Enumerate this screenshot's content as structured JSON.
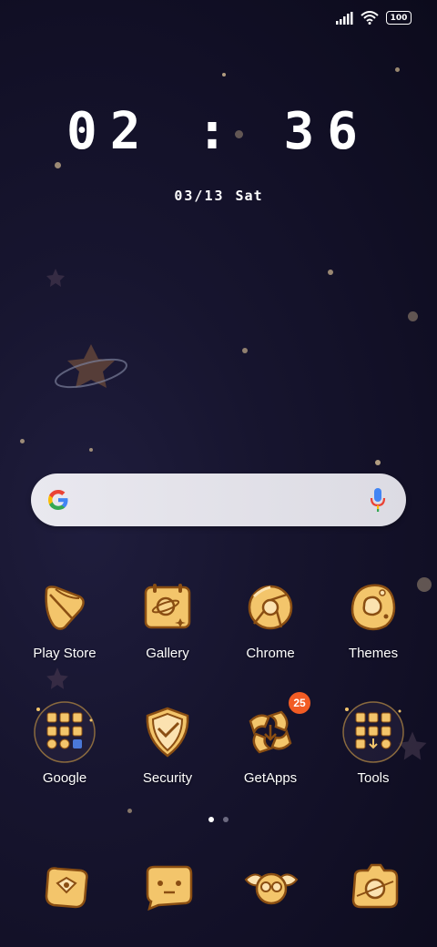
{
  "status_bar": {
    "signal_icon": "signal-bars-icon",
    "wifi_icon": "wifi-icon",
    "battery_level": "100"
  },
  "clock": {
    "time": "02 : 36",
    "date": "03/13",
    "weekday": "Sat"
  },
  "search": {
    "logo": "google-g-icon",
    "mic": "microphone-icon"
  },
  "apps": [
    {
      "label": "Play Store",
      "icon": "play-store-icon"
    },
    {
      "label": "Gallery",
      "icon": "gallery-icon"
    },
    {
      "label": "Chrome",
      "icon": "chrome-icon"
    },
    {
      "label": "Themes",
      "icon": "themes-icon"
    },
    {
      "label": "Google",
      "icon": "google-folder-icon"
    },
    {
      "label": "Security",
      "icon": "security-icon"
    },
    {
      "label": "GetApps",
      "icon": "getapps-icon",
      "badge": "25"
    },
    {
      "label": "Tools",
      "icon": "tools-folder-icon"
    }
  ],
  "page_indicator": {
    "pages": 2,
    "active": 1
  },
  "dock": [
    {
      "icon": "phone-dock-icon"
    },
    {
      "icon": "messages-dock-icon"
    },
    {
      "icon": "browser-dock-icon"
    },
    {
      "icon": "camera-dock-icon"
    }
  ],
  "colors": {
    "icon_fill": "#f3c56b",
    "icon_outline": "#8a4e12",
    "badge": "#f25c24"
  }
}
